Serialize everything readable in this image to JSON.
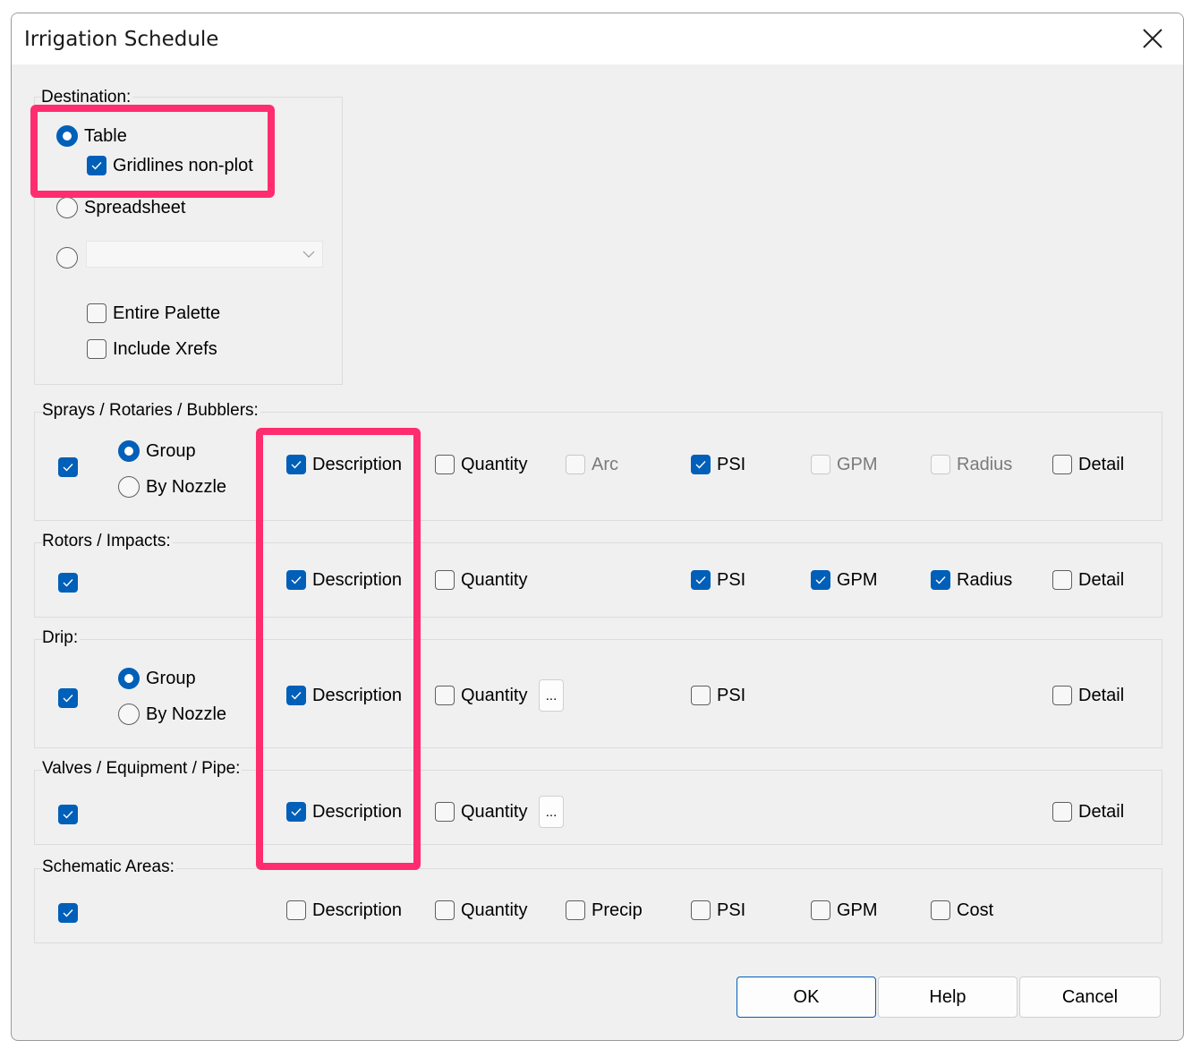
{
  "window": {
    "title": "Irrigation Schedule",
    "close_icon": "close-icon"
  },
  "colors": {
    "accent": "#005fb8",
    "highlight": "#ff2d6f"
  },
  "destination": {
    "label": "Destination:",
    "table": {
      "label": "Table",
      "selected": true
    },
    "gridlines": {
      "label": "Gridlines non-plot",
      "checked": true
    },
    "spreadsheet": {
      "label": "Spreadsheet",
      "selected": false
    },
    "other": {
      "selected": false,
      "combo_value": ""
    },
    "entire_palette": {
      "label": "Entire Palette",
      "checked": false
    },
    "include_xrefs": {
      "label": "Include Xrefs",
      "checked": false
    }
  },
  "sections": [
    {
      "label": "Sprays / Rotaries / Bubblers:",
      "enabled": true,
      "grouping": [
        {
          "label": "Group",
          "selected": true
        },
        {
          "label": "By Nozzle",
          "selected": false
        }
      ],
      "options": [
        {
          "col": "description",
          "label": "Description",
          "checked": true
        },
        {
          "col": "quantity",
          "label": "Quantity",
          "checked": false
        },
        {
          "col": "c3",
          "label": "Arc",
          "checked": false,
          "disabled": true
        },
        {
          "col": "psi",
          "label": "PSI",
          "checked": true
        },
        {
          "col": "gpm",
          "label": "GPM",
          "checked": false,
          "disabled": true
        },
        {
          "col": "c6",
          "label": "Radius",
          "checked": false,
          "disabled": true
        },
        {
          "col": "detail",
          "label": "Detail",
          "checked": false
        }
      ]
    },
    {
      "label": "Rotors / Impacts:",
      "enabled": true,
      "options": [
        {
          "col": "description",
          "label": "Description",
          "checked": true
        },
        {
          "col": "quantity",
          "label": "Quantity",
          "checked": false
        },
        {
          "col": "psi",
          "label": "PSI",
          "checked": true
        },
        {
          "col": "gpm",
          "label": "GPM",
          "checked": true
        },
        {
          "col": "c6",
          "label": "Radius",
          "checked": true
        },
        {
          "col": "detail",
          "label": "Detail",
          "checked": false
        }
      ]
    },
    {
      "label": "Drip:",
      "enabled": true,
      "grouping": [
        {
          "label": "Group",
          "selected": true
        },
        {
          "label": "By Nozzle",
          "selected": false
        }
      ],
      "ellipsis": "...",
      "options": [
        {
          "col": "description",
          "label": "Description",
          "checked": true
        },
        {
          "col": "quantity",
          "label": "Quantity",
          "checked": false
        },
        {
          "col": "psi",
          "label": "PSI",
          "checked": false
        },
        {
          "col": "detail",
          "label": "Detail",
          "checked": false
        }
      ]
    },
    {
      "label": "Valves / Equipment / Pipe:",
      "enabled": true,
      "ellipsis": "...",
      "options": [
        {
          "col": "description",
          "label": "Description",
          "checked": true
        },
        {
          "col": "quantity",
          "label": "Quantity",
          "checked": false
        },
        {
          "col": "detail",
          "label": "Detail",
          "checked": false
        }
      ]
    },
    {
      "label": "Schematic Areas:",
      "enabled": true,
      "options": [
        {
          "col": "description",
          "label": "Description",
          "checked": false
        },
        {
          "col": "quantity",
          "label": "Quantity",
          "checked": false
        },
        {
          "col": "c3",
          "label": "Precip",
          "checked": false
        },
        {
          "col": "psi",
          "label": "PSI",
          "checked": false
        },
        {
          "col": "gpm",
          "label": "GPM",
          "checked": false
        },
        {
          "col": "c6",
          "label": "Cost",
          "checked": false
        }
      ]
    }
  ],
  "buttons": {
    "ok": "OK",
    "help": "Help",
    "cancel": "Cancel"
  }
}
